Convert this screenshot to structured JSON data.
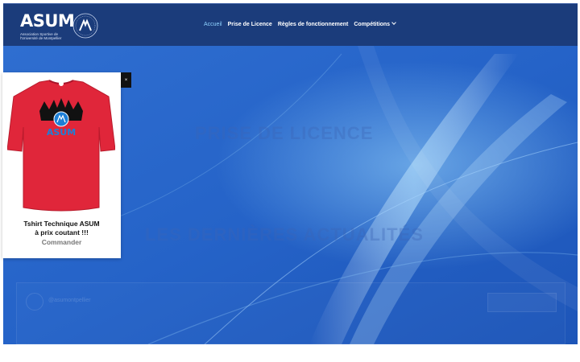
{
  "header": {
    "logo_text": "ASUM",
    "logo_subtitle": "Association Sportive de l'Université de Montpellier",
    "nav": [
      {
        "label": "Accueil",
        "active": true
      },
      {
        "label": "Prise de Licence",
        "active": false
      },
      {
        "label": "Règles de fonctionnement",
        "active": false
      },
      {
        "label": "Compétitions",
        "active": false,
        "has_dropdown": true
      }
    ]
  },
  "hero": {
    "heading_1": "PRISE DE LICENCE",
    "heading_2": "LES DERNIÈRES ACTUALITÉS",
    "social_handle": "@asumontpellier"
  },
  "promo": {
    "close_label": "×",
    "title_line_1": "Tshirt Technique ASUM",
    "title_line_2": "à prix coutant !!!",
    "cta": "Commander"
  },
  "colors": {
    "header_bg": "#1b3c7b",
    "hero_bg": "#2a63c6",
    "nav_active": "#8fd3ff",
    "tshirt_red": "#e0263a"
  }
}
